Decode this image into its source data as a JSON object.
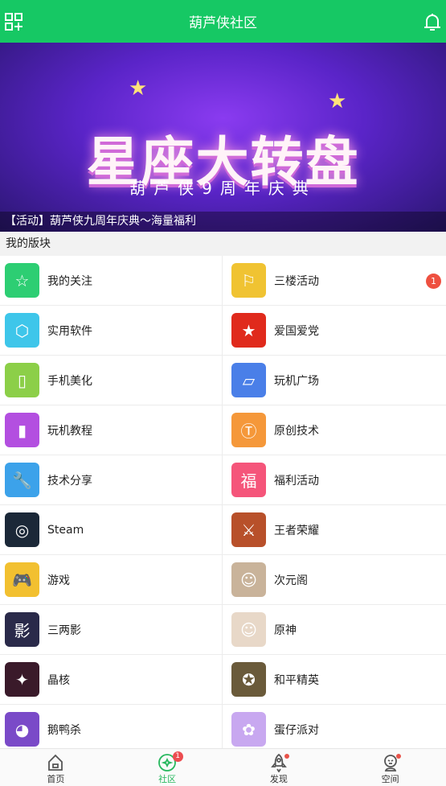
{
  "header": {
    "title": "葫芦侠社区",
    "left_icon": "grid-add-icon",
    "right_icon": "bell-icon"
  },
  "banner": {
    "logo_title": "星座大转盘",
    "logo_subtitle": "葫芦侠9周年庆典",
    "caption": "【活动】葫芦侠九周年庆典～海量福利"
  },
  "section": {
    "title": "我的版块"
  },
  "boards": [
    {
      "label": "我的关注",
      "color": "#2dce73",
      "glyph": "☆"
    },
    {
      "label": "三楼活动",
      "color": "#f0c332",
      "glyph": "⚐",
      "badge": "1"
    },
    {
      "label": "实用软件",
      "color": "#3ec6ea",
      "glyph": "⬡"
    },
    {
      "label": "爱国爱党",
      "color": "#e02a1c",
      "glyph": "★"
    },
    {
      "label": "手机美化",
      "color": "#8ccf48",
      "glyph": "▯"
    },
    {
      "label": "玩机广场",
      "color": "#4a7fe8",
      "glyph": "▱"
    },
    {
      "label": "玩机教程",
      "color": "#b34fe0",
      "glyph": "▮"
    },
    {
      "label": "原创技术",
      "color": "#f5983a",
      "glyph": "Ⓣ"
    },
    {
      "label": "技术分享",
      "color": "#3ca2ea",
      "glyph": "🔧"
    },
    {
      "label": "福利活动",
      "color": "#f5557a",
      "glyph": "福"
    },
    {
      "label": "Steam",
      "color": "#1b2838",
      "glyph": "◎"
    },
    {
      "label": "王者荣耀",
      "color": "#b8502a",
      "glyph": "⚔"
    },
    {
      "label": "游戏",
      "color": "#f2c030",
      "glyph": "🎮"
    },
    {
      "label": "次元阁",
      "color": "#c9b39a",
      "glyph": "☺"
    },
    {
      "label": "三两影",
      "color": "#2a2a4a",
      "glyph": "影"
    },
    {
      "label": "原神",
      "color": "#e8d8c8",
      "glyph": "☺"
    },
    {
      "label": "晶核",
      "color": "#3a1a2a",
      "glyph": "✦"
    },
    {
      "label": "和平精英",
      "color": "#6a5a3a",
      "glyph": "✪"
    },
    {
      "label": "鹅鸭杀",
      "color": "#7a4ac8",
      "glyph": "◕"
    },
    {
      "label": "蛋仔派对",
      "color": "#c8a8f0",
      "glyph": "✿"
    }
  ],
  "nav": [
    {
      "label": "首页",
      "icon": "home-icon",
      "active": false
    },
    {
      "label": "社区",
      "icon": "community-icon",
      "active": true,
      "badge": "1"
    },
    {
      "label": "发现",
      "icon": "rocket-icon",
      "active": false,
      "dot": true
    },
    {
      "label": "空间",
      "icon": "profile-icon",
      "active": false,
      "dot": true
    }
  ]
}
